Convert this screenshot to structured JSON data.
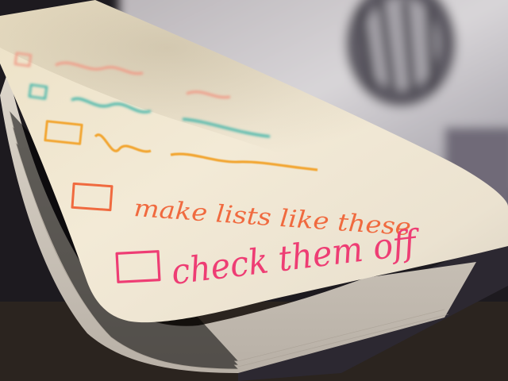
{
  "photo": {
    "subject": "notebook-checklist",
    "colors": {
      "table": "#2a2522",
      "paper": "#eee4cf",
      "paper_shadow": "#cfc5b4",
      "page_edges": "#d9d2c6",
      "cover": "#2e2a33",
      "background_blur": "#c8c5c8",
      "ink_pink": "#ee3d74",
      "ink_orange": "#f06a3f",
      "ink_yellow": "#f2a632",
      "ink_teal": "#3bb3a8",
      "ink_salmon": "#f09a86"
    },
    "checklist": [
      {
        "text": "",
        "ink": "salmon"
      },
      {
        "text": "",
        "ink": "teal"
      },
      {
        "text": "",
        "ink": "yellow"
      },
      {
        "text": "make lists like these",
        "ink": "orange"
      },
      {
        "text": "check them off",
        "ink": "pink"
      }
    ]
  }
}
